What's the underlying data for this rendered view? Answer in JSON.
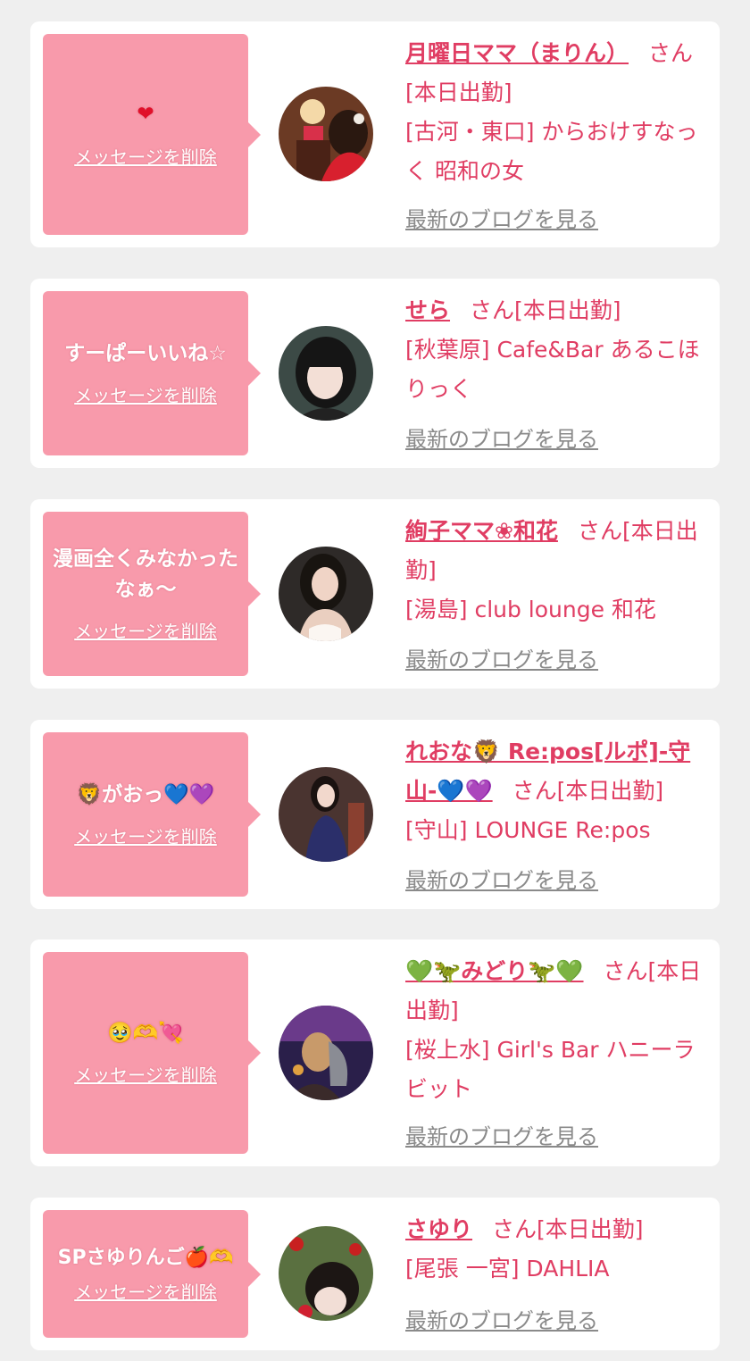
{
  "delete_label": "メッセージを削除",
  "blog_label": "最新のブログを見る",
  "cards": [
    {
      "message": "❤",
      "name": "月曜日ママ（まりん）",
      "suffix": "さん[本日出勤]",
      "shop": "[古河・東口] からおけすなっく 昭和の女"
    },
    {
      "message": "すーぱーいいね☆",
      "name": "せら",
      "suffix": "さん[本日出勤]",
      "shop": "[秋葉原] Cafe&Bar あるこほりっく"
    },
    {
      "message": "漫画全くみなかったなぁ〜",
      "name": "絢子ママ❀和花",
      "suffix": "さん[本日出勤]",
      "shop": "[湯島] club lounge 和花"
    },
    {
      "message": "🦁がおっ💙💜",
      "name": "れおな🦁 Re:pos[ルポ]-守山-💙💜",
      "suffix": "さん[本日出勤]",
      "shop": "[守山] LOUNGE Re:pos"
    },
    {
      "message": "🥹🫶💘",
      "name": "💚🦖みどり🦖💚",
      "suffix": "さん[本日出勤]",
      "shop": "[桜上水] Girl's Bar ハニーラビット"
    },
    {
      "message": "SPさゆりんご🍎🫶",
      "name": "さゆり",
      "suffix": "さん[本日出勤]",
      "shop": "[尾張 一宮] DAHLIA"
    }
  ]
}
